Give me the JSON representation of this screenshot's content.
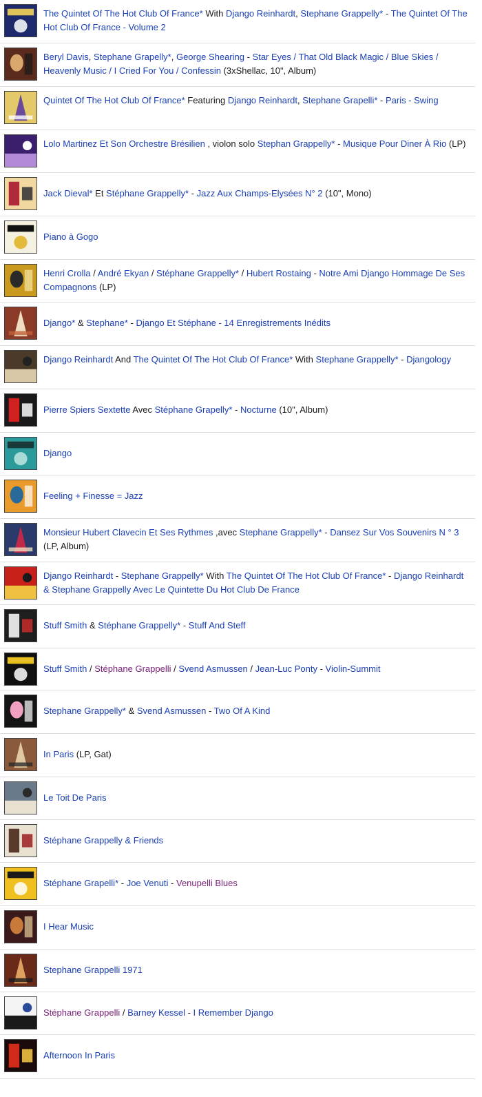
{
  "colors": {
    "link": "#1a3fb5",
    "visited": "#7a1f78",
    "text": "#1a1a1a",
    "divider": "#dcdcdc"
  },
  "rows": [
    {
      "thumb": {
        "icon": "album-cover-quintet-hot-club",
        "bg": "#1c2a6b",
        "fg": "#e0c25a",
        "accent": "#ffffff"
      },
      "parts": [
        {
          "t": "The Quintet Of The Hot Club Of France*",
          "s": "link"
        },
        {
          "t": " With ",
          "s": "plain"
        },
        {
          "t": "Django Reinhardt",
          "s": "link"
        },
        {
          "t": ", ",
          "s": "plain"
        },
        {
          "t": "Stephane Grappelly*",
          "s": "link"
        },
        {
          "t": " - ",
          "s": "plain"
        },
        {
          "t": "The Quintet Of The Hot Club Of France - Volume 2",
          "s": "link"
        }
      ]
    },
    {
      "thumb": {
        "icon": "album-cover-portrait",
        "bg": "#5a2a1c",
        "fg": "#d9a66b",
        "accent": "#1a1a1a"
      },
      "parts": [
        {
          "t": "Beryl Davis",
          "s": "link"
        },
        {
          "t": ", ",
          "s": "plain"
        },
        {
          "t": "Stephane Grapelly*",
          "s": "link"
        },
        {
          "t": ", ",
          "s": "plain"
        },
        {
          "t": "George Shearing",
          "s": "link"
        },
        {
          "t": " - ",
          "s": "plain"
        },
        {
          "t": "Star Eyes / That Old Black Magic / Blue Skies / Heavenly Music / I Cried For You / Confessin",
          "s": "link"
        },
        {
          "t": " (3xShellac, 10\", Album)",
          "s": "plain"
        }
      ]
    },
    {
      "thumb": {
        "icon": "album-cover-eiffel-guitar",
        "bg": "#e3c96a",
        "fg": "#6a4a9a",
        "accent": "#ffffff"
      },
      "parts": [
        {
          "t": "Quintet Of The Hot Club Of France*",
          "s": "link"
        },
        {
          "t": " Featuring ",
          "s": "plain"
        },
        {
          "t": "Django Reinhardt",
          "s": "link"
        },
        {
          "t": ", ",
          "s": "plain"
        },
        {
          "t": "Stephane Grapelli*",
          "s": "link"
        },
        {
          "t": " - ",
          "s": "plain"
        },
        {
          "t": "Paris - Swing",
          "s": "link"
        }
      ]
    },
    {
      "thumb": {
        "icon": "album-cover-purple-rio",
        "bg": "#3b1f6e",
        "fg": "#b28ad8",
        "accent": "#ffffff"
      },
      "parts": [
        {
          "t": "Lolo Martinez Et Son Orchestre Brésilien",
          "s": "link"
        },
        {
          "t": " , violon solo ",
          "s": "plain"
        },
        {
          "t": "Stephan Grappelly*",
          "s": "link"
        },
        {
          "t": " - ",
          "s": "plain"
        },
        {
          "t": "Musique Pour Diner À Rio",
          "s": "link"
        },
        {
          "t": " (LP)",
          "s": "plain"
        }
      ]
    },
    {
      "thumb": {
        "icon": "album-cover-champs-elysees",
        "bg": "#f0d8a0",
        "fg": "#b02a3a",
        "accent": "#3a3a3a"
      },
      "parts": [
        {
          "t": "Jack Dieval*",
          "s": "link"
        },
        {
          "t": " Et ",
          "s": "plain"
        },
        {
          "t": "Stéphane Grappelly*",
          "s": "link"
        },
        {
          "t": " - ",
          "s": "plain"
        },
        {
          "t": "Jazz Aux Champs-Elysées N° 2",
          "s": "link"
        },
        {
          "t": " (10\", Mono)",
          "s": "plain"
        }
      ]
    },
    {
      "thumb": {
        "icon": "album-cover-piano-keys",
        "bg": "#f4f1e0",
        "fg": "#111111",
        "accent": "#e0b020"
      },
      "parts": [
        {
          "t": "Piano à Gogo",
          "s": "link"
        }
      ]
    },
    {
      "thumb": {
        "icon": "album-cover-django-yellow",
        "bg": "#c99a1e",
        "fg": "#2a2a2a",
        "accent": "#f6e7a8"
      },
      "parts": [
        {
          "t": "Henri Crolla",
          "s": "link"
        },
        {
          "t": " / ",
          "s": "plain"
        },
        {
          "t": "André Ekyan",
          "s": "link"
        },
        {
          "t": " / ",
          "s": "plain"
        },
        {
          "t": "Stéphane Grappelly*",
          "s": "link"
        },
        {
          "t": " / ",
          "s": "plain"
        },
        {
          "t": "Hubert Rostaing",
          "s": "link"
        },
        {
          "t": " - ",
          "s": "plain"
        },
        {
          "t": "Notre Ami Django Hommage De Ses Compagnons",
          "s": "link"
        },
        {
          "t": " (LP)",
          "s": "plain"
        }
      ]
    },
    {
      "thumb": {
        "icon": "album-cover-django-stephane",
        "bg": "#8a3a26",
        "fg": "#f0dcc0",
        "accent": "#c0603a"
      },
      "parts": [
        {
          "t": "Django*",
          "s": "link"
        },
        {
          "t": " & ",
          "s": "plain"
        },
        {
          "t": "Stephane*",
          "s": "link"
        },
        {
          "t": " - ",
          "s": "plain"
        },
        {
          "t": "Django Et Stéphane - 14 Enregistrements Inédits",
          "s": "link"
        }
      ]
    },
    {
      "thumb": {
        "icon": "album-cover-djangology",
        "bg": "#4a3a2a",
        "fg": "#d8c8a8",
        "accent": "#222222"
      },
      "parts": [
        {
          "t": "Django Reinhardt",
          "s": "link"
        },
        {
          "t": " And ",
          "s": "plain"
        },
        {
          "t": "The Quintet Of The Hot Club Of France*",
          "s": "link"
        },
        {
          "t": " With ",
          "s": "plain"
        },
        {
          "t": "Stephane Grappelly*",
          "s": "link"
        },
        {
          "t": " - ",
          "s": "plain"
        },
        {
          "t": "Djangology",
          "s": "link"
        }
      ]
    },
    {
      "thumb": {
        "icon": "album-cover-nocturne",
        "bg": "#1a1a1a",
        "fg": "#d02020",
        "accent": "#f0f0f0"
      },
      "parts": [
        {
          "t": "Pierre Spiers Sextette",
          "s": "link"
        },
        {
          "t": " Avec ",
          "s": "plain"
        },
        {
          "t": "Stéphane Grapelly*",
          "s": "link"
        },
        {
          "t": " - ",
          "s": "plain"
        },
        {
          "t": "Nocturne",
          "s": "link"
        },
        {
          "t": " (10\", Album)",
          "s": "plain"
        }
      ]
    },
    {
      "thumb": {
        "icon": "album-cover-django-teal",
        "bg": "#2a9a9a",
        "fg": "#1a3a3a",
        "accent": "#bfe8e0"
      },
      "parts": [
        {
          "t": "Django",
          "s": "link"
        }
      ]
    },
    {
      "thumb": {
        "icon": "album-cover-feeling-finesse",
        "bg": "#e89a2a",
        "fg": "#2a6a9a",
        "accent": "#ffffff"
      },
      "parts": [
        {
          "t": "Feeling + Finesse = Jazz",
          "s": "link"
        }
      ]
    },
    {
      "thumb": {
        "icon": "album-cover-souvenirs",
        "bg": "#2a3a6a",
        "fg": "#c02a4a",
        "accent": "#f0e0c0"
      },
      "parts": [
        {
          "t": "Monsieur Hubert Clavecin Et Ses Rythmes",
          "s": "link"
        },
        {
          "t": " ,avec ",
          "s": "plain"
        },
        {
          "t": "Stephane Grappelly*",
          "s": "link"
        },
        {
          "t": " - ",
          "s": "plain"
        },
        {
          "t": "Dansez Sur Vos Souvenirs N ° 3",
          "s": "link"
        },
        {
          "t": " (LP, Album)",
          "s": "plain"
        }
      ]
    },
    {
      "thumb": {
        "icon": "album-cover-red-django",
        "bg": "#c8201a",
        "fg": "#f0c040",
        "accent": "#1a1a1a"
      },
      "parts": [
        {
          "t": "Django Reinhardt",
          "s": "link"
        },
        {
          "t": " - ",
          "s": "plain"
        },
        {
          "t": "Stephane Grappelly*",
          "s": "link"
        },
        {
          "t": " With ",
          "s": "plain"
        },
        {
          "t": "The Quintet Of The Hot Club Of France*",
          "s": "link"
        },
        {
          "t": " - ",
          "s": "plain"
        },
        {
          "t": "Django Reinhardt & Stephane Grappelly Avec Le Quintette Du Hot Club De France",
          "s": "link"
        }
      ]
    },
    {
      "thumb": {
        "icon": "album-cover-stuff-and-steff",
        "bg": "#1e1e1e",
        "fg": "#e0e0e0",
        "accent": "#c02a2a"
      },
      "parts": [
        {
          "t": "Stuff Smith",
          "s": "link"
        },
        {
          "t": " & ",
          "s": "plain"
        },
        {
          "t": "Stéphane Grappelly*",
          "s": "link"
        },
        {
          "t": " - ",
          "s": "plain"
        },
        {
          "t": "Stuff And Steff",
          "s": "link"
        }
      ]
    },
    {
      "thumb": {
        "icon": "album-cover-violin-summit",
        "bg": "#101010",
        "fg": "#e8c020",
        "accent": "#ffffff"
      },
      "parts": [
        {
          "t": "Stuff Smith",
          "s": "link"
        },
        {
          "t": " / ",
          "s": "plain"
        },
        {
          "t": "Stéphane Grappelli",
          "s": "visited"
        },
        {
          "t": " / ",
          "s": "plain"
        },
        {
          "t": "Svend Asmussen",
          "s": "link"
        },
        {
          "t": " / ",
          "s": "plain"
        },
        {
          "t": "Jean-Luc Ponty",
          "s": "link"
        },
        {
          "t": " - ",
          "s": "plain"
        },
        {
          "t": "Violin-Summit",
          "s": "link"
        }
      ]
    },
    {
      "thumb": {
        "icon": "album-cover-two-of-a-kind",
        "bg": "#141414",
        "fg": "#f0a0c0",
        "accent": "#ffffff"
      },
      "parts": [
        {
          "t": "Stephane Grappelly*",
          "s": "link"
        },
        {
          "t": " & ",
          "s": "plain"
        },
        {
          "t": "Svend Asmussen",
          "s": "link"
        },
        {
          "t": " - ",
          "s": "plain"
        },
        {
          "t": "Two Of A Kind",
          "s": "link"
        }
      ]
    },
    {
      "thumb": {
        "icon": "album-cover-in-paris",
        "bg": "#8a5a3a",
        "fg": "#e0c8a0",
        "accent": "#2a2a2a"
      },
      "parts": [
        {
          "t": "In Paris",
          "s": "link"
        },
        {
          "t": " (LP, Gat)",
          "s": "plain"
        }
      ]
    },
    {
      "thumb": {
        "icon": "album-cover-le-toit-de-paris",
        "bg": "#6a7a8a",
        "fg": "#e8e0d0",
        "accent": "#2a2a2a"
      },
      "parts": [
        {
          "t": "Le Toit De Paris",
          "s": "link"
        }
      ]
    },
    {
      "thumb": {
        "icon": "album-cover-grappelly-friends",
        "bg": "#e8e0d0",
        "fg": "#5a3a2a",
        "accent": "#a02a2a"
      },
      "parts": [
        {
          "t": "Stéphane Grappelly & Friends",
          "s": "link"
        }
      ]
    },
    {
      "thumb": {
        "icon": "album-cover-venupelli-blues",
        "bg": "#f0c020",
        "fg": "#1a1a1a",
        "accent": "#ffffff"
      },
      "parts": [
        {
          "t": "Stéphane Grapelli*",
          "s": "link"
        },
        {
          "t": " - ",
          "s": "plain"
        },
        {
          "t": "Joe Venuti",
          "s": "link"
        },
        {
          "t": " - ",
          "s": "plain"
        },
        {
          "t": "Venupelli Blues",
          "s": "visited"
        }
      ]
    },
    {
      "thumb": {
        "icon": "album-cover-i-hear-music",
        "bg": "#3a1a1a",
        "fg": "#c87a3a",
        "accent": "#e8d0a0"
      },
      "parts": [
        {
          "t": "I Hear Music",
          "s": "link"
        }
      ]
    },
    {
      "thumb": {
        "icon": "album-cover-grappelli-1971",
        "bg": "#6a2a1a",
        "fg": "#e0a060",
        "accent": "#1a1a1a"
      },
      "parts": [
        {
          "t": "Stephane Grappelli 1971",
          "s": "link"
        }
      ]
    },
    {
      "thumb": {
        "icon": "album-cover-i-remember-django",
        "bg": "#f4f4f4",
        "fg": "#1a1a1a",
        "accent": "#2a4a9a"
      },
      "parts": [
        {
          "t": "Stéphane Grappelli",
          "s": "visited"
        },
        {
          "t": " / ",
          "s": "plain"
        },
        {
          "t": "Barney Kessel",
          "s": "link"
        },
        {
          "t": " - ",
          "s": "plain"
        },
        {
          "t": "I Remember Django",
          "s": "link"
        }
      ]
    },
    {
      "thumb": {
        "icon": "album-cover-afternoon-in-paris",
        "bg": "#1a0a0a",
        "fg": "#d02a1a",
        "accent": "#f0c040"
      },
      "parts": [
        {
          "t": "Afternoon In Paris",
          "s": "link"
        }
      ]
    }
  ]
}
